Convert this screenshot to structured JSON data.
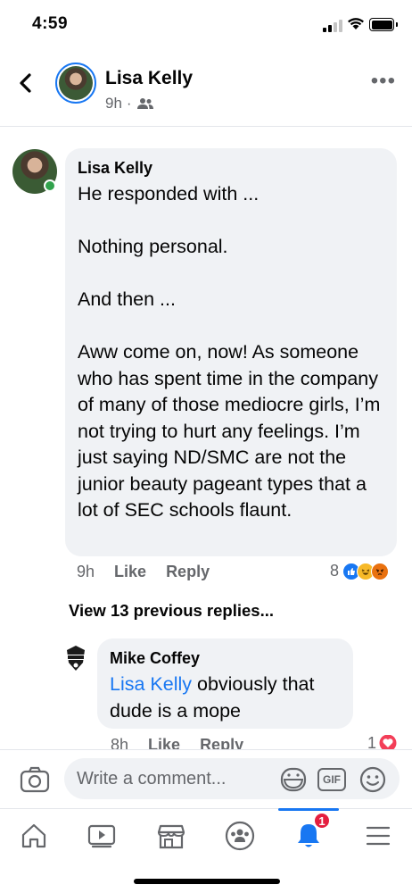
{
  "status_bar": {
    "time": "4:59"
  },
  "header": {
    "name": "Lisa Kelly",
    "time": "9h",
    "separator": "·"
  },
  "comment": {
    "author": "Lisa Kelly",
    "text": "He responded with ...\n\nNothing personal.\n\nAnd then ...\n\nAww come on, now! As someone who has spent time in the company of many of those mediocre girls, I’m not trying to hurt any feelings. I’m just saying ND/SMC are not the junior beauty pageant types that a lot of SEC schools flaunt.",
    "time": "9h",
    "like_label": "Like",
    "reply_label": "Reply",
    "reaction_count": "8",
    "reactions": [
      "like-icon",
      "haha-icon",
      "angry-icon"
    ]
  },
  "view_replies_label": "View 13 previous replies...",
  "reply": {
    "author": "Mike Coffey",
    "mention": "Lisa Kelly",
    "text": " obviously that dude is a mope",
    "time": "8h",
    "like_label": "Like",
    "reply_label": "Reply",
    "reaction_count": "1"
  },
  "composer": {
    "placeholder": "Write a comment...",
    "gif_label": "GIF"
  },
  "tabbar": {
    "tabs": [
      "home-icon",
      "video-icon",
      "marketplace-icon",
      "groups-icon",
      "notifications-icon",
      "menu-icon"
    ],
    "notification_badge": "1",
    "active_tab": "notifications"
  },
  "colors": {
    "accent": "#1877f2",
    "bubble": "#f0f2f5",
    "secondary_text": "#65676b",
    "badge": "#e41e3f",
    "online": "#31a24c"
  }
}
